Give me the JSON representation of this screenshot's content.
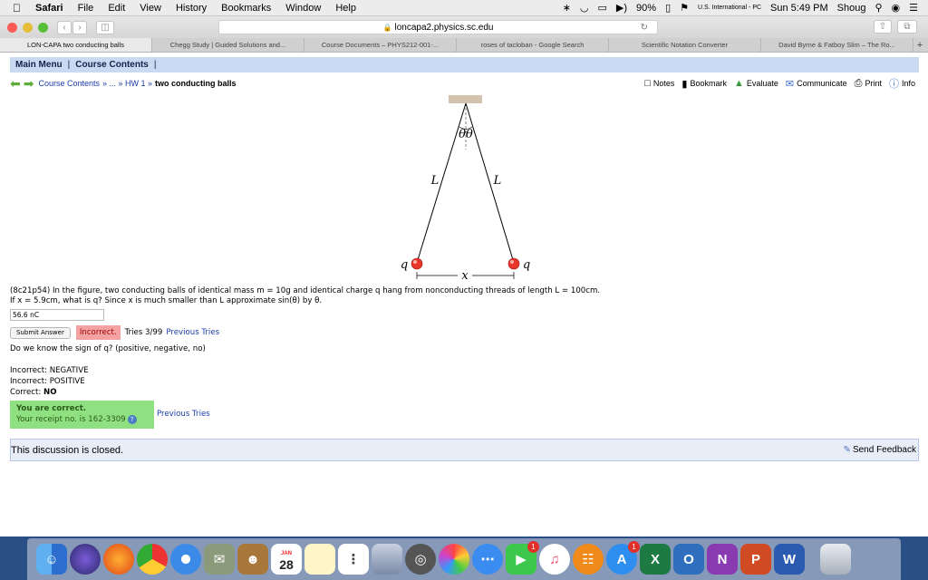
{
  "menubar": {
    "app": "Safari",
    "items": [
      "File",
      "Edit",
      "View",
      "History",
      "Bookmarks",
      "Window",
      "Help"
    ],
    "battery": "90%",
    "input_source": "U.S. International - PC",
    "clock": "Sun 5:49 PM",
    "user": "Shoug"
  },
  "toolbar": {
    "url": "loncapa2.physics.sc.edu"
  },
  "tabs": [
    "LON-CAPA two conducting balls",
    "Chegg Study | Guided Solutions and...",
    "Course Documents – PHYS212-001-...",
    "roses of tacloban - Google Search",
    "Scientific Notation Converter",
    "David Byrne & Fatboy Slim – The Ro..."
  ],
  "tab_plus": "+",
  "mainmenu": {
    "main": "Main Menu",
    "sep": "|",
    "contents": "Course Contents",
    "sep2": "|"
  },
  "breadcrumb": {
    "link": "Course Contents",
    "middle": "» ... » HW 1 »",
    "current": "two conducting balls"
  },
  "tools": [
    "Notes",
    "Bookmark",
    "Evaluate",
    "Communicate",
    "Print",
    "Info"
  ],
  "figure": {
    "theta": "θθ",
    "left_length": "L",
    "right_length": "L",
    "left_charge": "q",
    "right_charge": "q",
    "separation": "x"
  },
  "problem": {
    "line1": "(8c21p54) In the figure, two conducting balls of identical mass m = 10g and identical charge q hang from nonconducting threads of length L = 100cm.",
    "line2": "If x = 5.9cm, what is q? Since x is much smaller than L approximate sin(θ) by θ.",
    "answer": "56.6 nC",
    "submit": "Submit Answer",
    "status": "Incorrect.",
    "tries": "Tries 3/99",
    "previous": "Previous Tries"
  },
  "question2": {
    "text": "Do we know the sign of q? (positive, negative, no)",
    "history": [
      "Incorrect: NEGATIVE",
      "Incorrect: POSITIVE"
    ],
    "correct_label": "Correct:",
    "correct_value": "NO"
  },
  "result": {
    "title": "You are correct.",
    "receipt": "Your receipt no. is 162-3309",
    "help": "?",
    "previous": "Previous Tries"
  },
  "discussion": {
    "closed": "This discussion is closed.",
    "feedback": "Send Feedback"
  },
  "dock": {
    "calendar_month": "JAN",
    "calendar_day": "28",
    "appstore_badge": "1",
    "facetime_badge": "1"
  },
  "colors": {
    "menu_band": "#c9d9f2",
    "incorrect": "#f4a2a2",
    "correct": "#8fe080",
    "ball": "#e8362a"
  }
}
